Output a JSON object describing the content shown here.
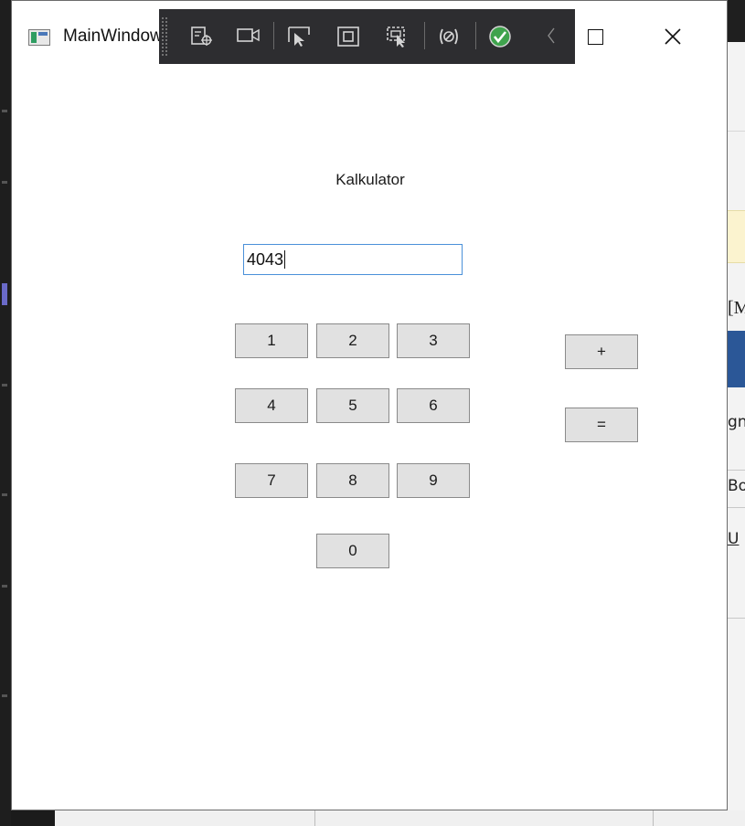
{
  "window": {
    "title": "MainWindow"
  },
  "debug_toolbar": {
    "icons": [
      "select-element-icon",
      "record-icon",
      "select-pointer-icon",
      "display-layout-adorners-icon",
      "track-focus-icon",
      "hot-reload-icon",
      "binding-check-icon",
      "collapse-chevron-icon"
    ]
  },
  "calculator": {
    "heading": "Kalkulator",
    "display_value": "4043",
    "digits": {
      "one": "1",
      "two": "2",
      "three": "3",
      "four": "4",
      "five": "5",
      "six": "6",
      "seven": "7",
      "eight": "8",
      "nine": "9",
      "zero": "0"
    },
    "operators": {
      "plus": "+",
      "equals": "="
    }
  },
  "background_app": {
    "fragments": [
      "[M",
      "gn",
      "Boc",
      "U"
    ]
  },
  "colors": {
    "accent_focus": "#4a90d9",
    "button_face": "#e1e1e1",
    "toolbar_bg": "#2d2d30",
    "check_green": "#3fa34d"
  }
}
